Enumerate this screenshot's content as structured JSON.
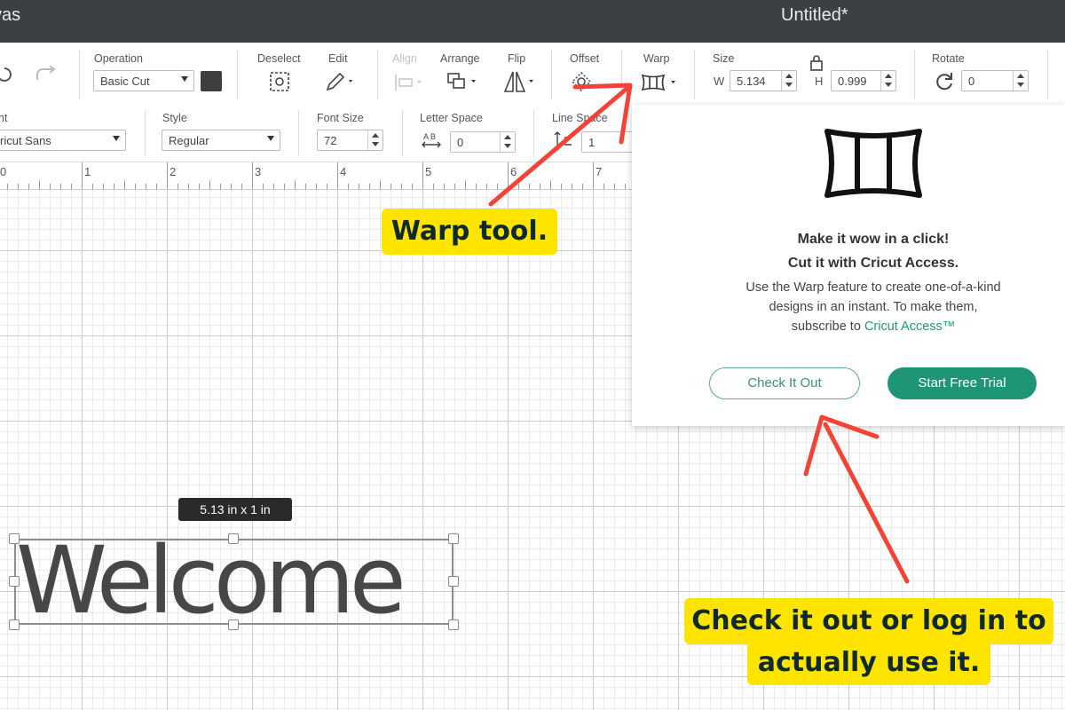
{
  "titlebar": {
    "left_text": "vas",
    "title": "Untitled*"
  },
  "toolbar": {
    "operation_label": "Operation",
    "operation_value": "Basic Cut",
    "deselect_label": "Deselect",
    "edit_label": "Edit",
    "align_label": "Align",
    "arrange_label": "Arrange",
    "flip_label": "Flip",
    "offset_label": "Offset",
    "warp_label": "Warp",
    "size_label": "Size",
    "w_label": "W",
    "w_value": "5.134",
    "h_label": "H",
    "h_value": "0.999",
    "rotate_label": "Rotate",
    "rotate_value": "0"
  },
  "text_toolbar": {
    "font_label": "nt",
    "font_value": "ricut Sans",
    "style_label": "Style",
    "style_value": "Regular",
    "font_size_label": "Font Size",
    "font_size_value": "72",
    "letter_space_label": "Letter Space",
    "letter_space_value": "0",
    "line_space_label": "Line Space",
    "line_space_value": "1"
  },
  "ruler": {
    "ticks": [
      "0",
      "1",
      "2",
      "3",
      "4",
      "5",
      "6",
      "7"
    ]
  },
  "popup": {
    "headline1": "Make it wow in a click!",
    "headline2": "Cut it with Cricut Access.",
    "body1": "Use the Warp feature to create one-of-a-kind",
    "body2": "designs in an instant. To make them,",
    "body3_prefix": "subscribe to ",
    "body3_link": "Cricut Access™",
    "check_button": "Check It Out",
    "trial_button": "Start Free Trial"
  },
  "canvas": {
    "size_tooltip": "5.13  in x 1  in",
    "text_object": "Welcome"
  },
  "annotations": {
    "warp_callout": "Warp tool.",
    "check_callout_line1": "Check it out or log in to",
    "check_callout_line2": "actually use it."
  },
  "colors": {
    "titlebar": "#3d4043",
    "accent_green": "#1e9575",
    "callout_yellow": "#ffe400",
    "arrow_red": "#f44336"
  }
}
